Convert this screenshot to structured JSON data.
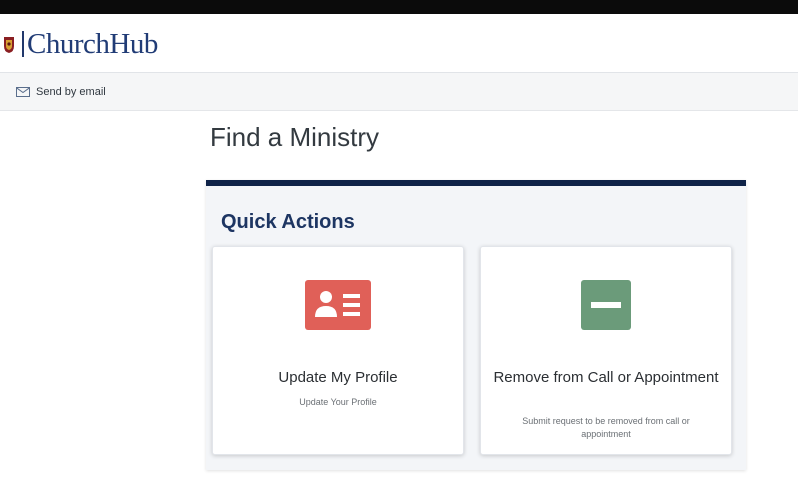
{
  "brand": {
    "name": "ChurchHub"
  },
  "toolbar": {
    "send_email_label": "Send by email"
  },
  "page": {
    "title": "Find a Ministry"
  },
  "quick_actions": {
    "title": "Quick Actions",
    "cards": [
      {
        "title": "Update My Profile",
        "subtitle": "Update Your Profile",
        "icon": "profile-card-icon",
        "color": "#e06058"
      },
      {
        "title": "Remove from Call or Appointment",
        "subtitle": "Submit request to be removed from call or appointment",
        "icon": "minus-icon",
        "color": "#6b9b7a"
      }
    ]
  },
  "colors": {
    "brand": "#213c76",
    "panel_accent": "#0f2348",
    "heading": "#1d3562"
  }
}
